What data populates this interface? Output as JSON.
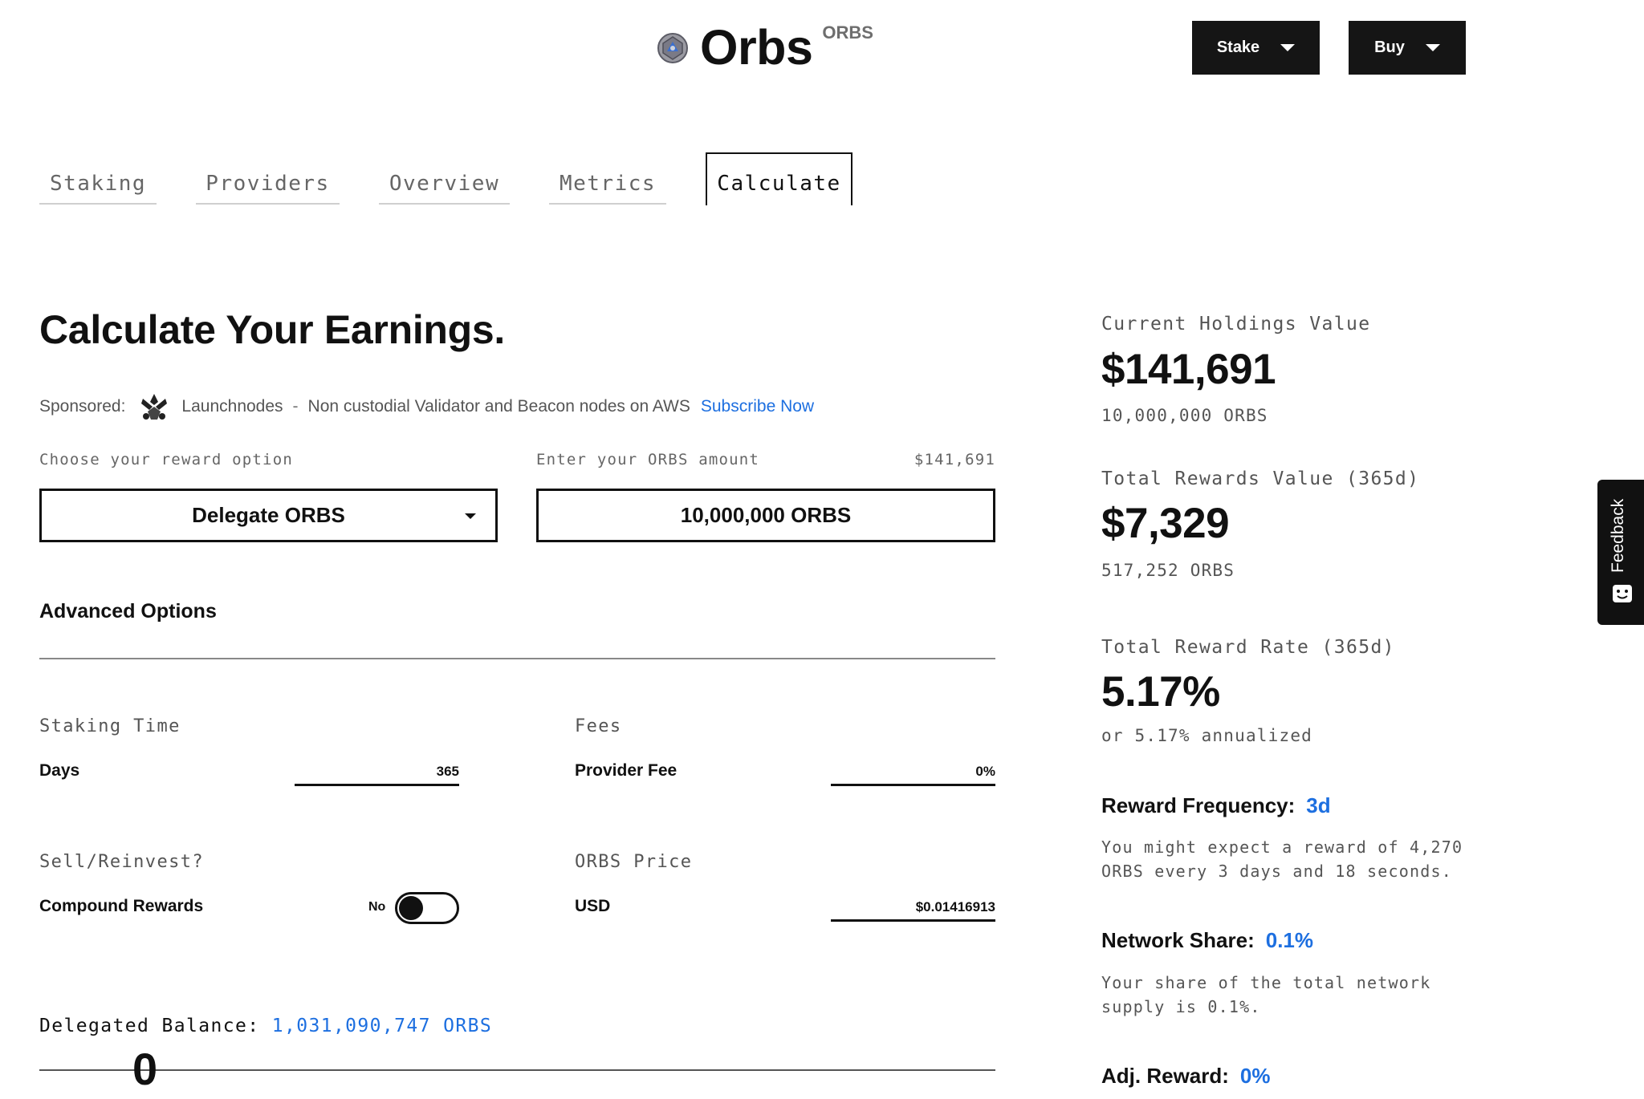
{
  "header": {
    "title": "Orbs",
    "ticker": "ORBS",
    "stake_label": "Stake",
    "buy_label": "Buy"
  },
  "tabs": [
    {
      "label": "Staking"
    },
    {
      "label": "Providers"
    },
    {
      "label": "Overview"
    },
    {
      "label": "Metrics"
    },
    {
      "label": "Calculate",
      "active": true
    }
  ],
  "calculator": {
    "heading": "Calculate Your Earnings.",
    "sponsored": {
      "prefix": "Sponsored:",
      "name": "Launchnodes",
      "separator": "-",
      "description": "Non custodial Validator and Beacon nodes on AWS",
      "link": "Subscribe Now"
    },
    "reward_option_label": "Choose your reward option",
    "reward_option_value": "Delegate ORBS",
    "amount_label": "Enter your ORBS amount",
    "amount_usd": "$141,691",
    "amount_value": "10,000,000 ORBS",
    "advanced_title": "Advanced Options",
    "staking_time": {
      "section": "Staking Time",
      "label": "Days",
      "value": "365"
    },
    "fees": {
      "section": "Fees",
      "label": "Provider Fee",
      "value": "0%"
    },
    "reinvest": {
      "section": "Sell/Reinvest?",
      "label": "Compound Rewards",
      "toggle_text": "No",
      "toggle_on": false
    },
    "price": {
      "section": "ORBS Price",
      "label": "USD",
      "value": "$0.01416913"
    },
    "delegated": {
      "label": "Delegated Balance:",
      "value": "1,031,090,747 ORBS",
      "slider_value": "0"
    }
  },
  "summary": {
    "holdings_label": "Current Holdings Value",
    "holdings_value": "$141,691",
    "holdings_orbs": "10,000,000 ORBS",
    "rewards_label": "Total Rewards Value (365d)",
    "rewards_value": "$7,329",
    "rewards_orbs": "517,252 ORBS",
    "rate_label": "Total Reward Rate (365d)",
    "rate_value": "5.17%",
    "rate_note": "or 5.17% annualized",
    "frequency_label": "Reward Frequency:",
    "frequency_value": "3d",
    "frequency_desc": "You might expect a reward of 4,270 ORBS every 3 days and 18 seconds.",
    "share_label": "Network Share:",
    "share_value": "0.1%",
    "share_desc": "Your share of the total network supply is 0.1%.",
    "adj_label": "Adj. Reward:",
    "adj_value": "0%"
  },
  "feedback": {
    "label": "Feedback"
  },
  "colors": {
    "accent": "#1d6fe0",
    "dark": "#151515"
  }
}
